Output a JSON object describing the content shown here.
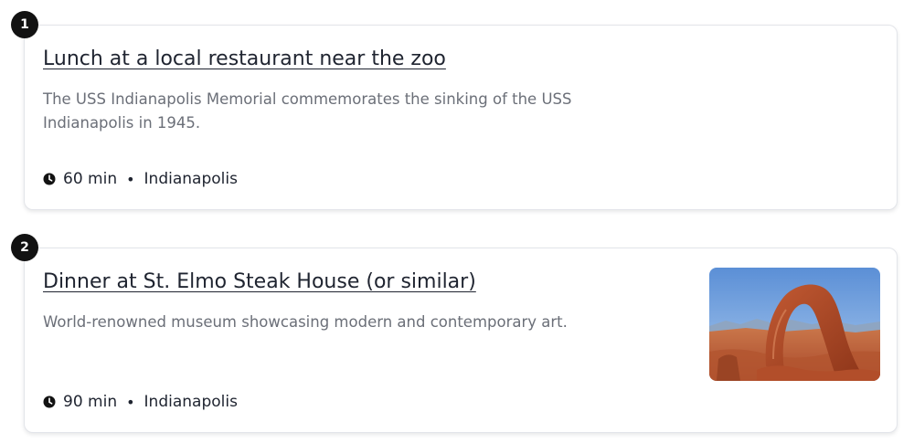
{
  "itinerary": {
    "items": [
      {
        "number": "1",
        "title": "Lunch at a local restaurant near the zoo",
        "description": "The USS Indianapolis Memorial commemorates the sinking of the USS Indianapolis in 1945.",
        "duration": "60 min",
        "separator": "•",
        "location": "Indianapolis",
        "icon": "clock-icon"
      },
      {
        "number": "2",
        "title": "Dinner at St. Elmo Steak House (or similar)",
        "description": "World-renowned museum showcasing modern and contemporary art.",
        "duration": "90 min",
        "separator": "•",
        "location": "Indianapolis",
        "icon": "clock-icon",
        "image": "red-rock-arch-photo"
      }
    ]
  },
  "colors": {
    "badge_bg": "#121212",
    "title_text": "#1f2430",
    "description_text": "#6b6f78",
    "card_border": "#e3e5ea"
  }
}
